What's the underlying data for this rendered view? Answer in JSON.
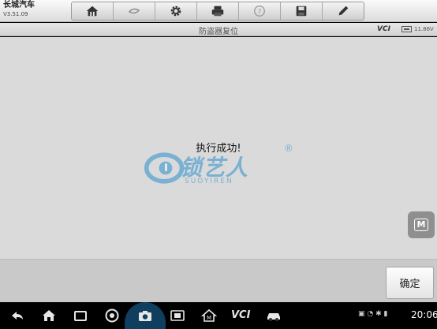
{
  "app": {
    "name": "长城汽车",
    "version": "V3.51.09"
  },
  "toolbar": {
    "items": [
      {
        "icon": "home-icon"
      },
      {
        "icon": "car-swap-icon"
      },
      {
        "icon": "gear-icon"
      },
      {
        "icon": "printer-icon"
      },
      {
        "icon": "help-icon"
      },
      {
        "icon": "save-icon"
      },
      {
        "icon": "pen-icon"
      }
    ]
  },
  "header": {
    "title": "防盗器复位",
    "vci_label": "VCI",
    "voltage": "11.86V"
  },
  "main": {
    "message": "执行成功!",
    "watermark": {
      "brand": "锁艺人",
      "sub": "SUOYIREN",
      "reg": "®"
    }
  },
  "side_button": {
    "label": "M"
  },
  "actions": {
    "ok_label": "确定"
  },
  "navbar": {
    "vci_label": "VCI",
    "time": "20:06"
  },
  "colors": {
    "accent": "#2d8fcc",
    "main_bg": "#dadada",
    "action_bg": "#c9c9c9"
  }
}
